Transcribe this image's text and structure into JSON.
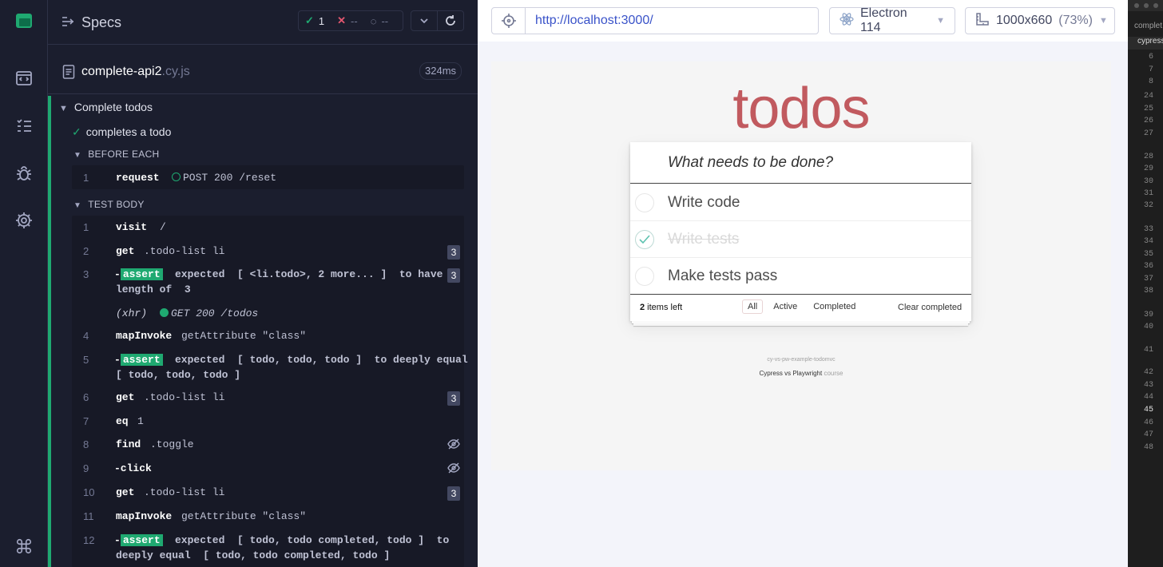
{
  "reporter": {
    "header": {
      "title": "Specs"
    },
    "stats": {
      "passed": "1",
      "failed": "--",
      "pending": "--"
    },
    "spec": {
      "name": "complete-api2",
      "ext": ".cy.js",
      "duration": "324ms"
    },
    "suite": {
      "title": "Complete todos"
    },
    "test": {
      "title": "completes a todo"
    },
    "before_each": {
      "label": "BEFORE EACH",
      "commands": [
        {
          "num": "1",
          "name": "request",
          "msg": "POST 200 /reset"
        }
      ]
    },
    "test_body": {
      "label": "TEST BODY",
      "commands": [
        {
          "num": "1",
          "name": "visit",
          "msg": "/"
        },
        {
          "num": "2",
          "name": "get",
          "msg": ".todo-list li",
          "count": "3"
        },
        {
          "num": "3",
          "name": "-assert",
          "badge": "assert",
          "line1": "expected  [ <li.todo>, 2 more... ]  to have a",
          "line2": "length of  3",
          "count": "3"
        },
        {
          "num": "",
          "name": "(xhr)",
          "msg": "GET 200 /todos"
        },
        {
          "num": "4",
          "name": "mapInvoke",
          "msg": "getAttribute \"class\""
        },
        {
          "num": "5",
          "name": "-assert",
          "badge": "assert",
          "line1": "expected  [ todo, todo, todo ]  to deeply equal",
          "line2": "[ todo, todo, todo ]"
        },
        {
          "num": "6",
          "name": "get",
          "msg": ".todo-list li",
          "count": "3"
        },
        {
          "num": "7",
          "name": "eq",
          "msg": "1"
        },
        {
          "num": "8",
          "name": "find",
          "msg": ".toggle"
        },
        {
          "num": "9",
          "name": "-click",
          "msg": ""
        },
        {
          "num": "10",
          "name": "get",
          "msg": ".todo-list li",
          "count": "3"
        },
        {
          "num": "11",
          "name": "mapInvoke",
          "msg": "getAttribute \"class\""
        },
        {
          "num": "12",
          "name": "-assert",
          "badge": "assert",
          "line1": "expected  [ todo, todo completed, todo ]  to",
          "line2": "deeply equal  [ todo, todo completed, todo ]"
        }
      ]
    }
  },
  "aut": {
    "url": "http://localhost:3000/",
    "browser": "Electron 114",
    "viewport": "1000x660",
    "zoom": "(73%)",
    "app": {
      "title": "todos",
      "placeholder": "What needs to be done?",
      "items": [
        {
          "label": "Write code",
          "completed": false
        },
        {
          "label": "Write tests",
          "completed": true
        },
        {
          "label": "Make tests pass",
          "completed": false
        }
      ],
      "footer": {
        "count": "2",
        "count_suffix": " items left",
        "filters": [
          "All",
          "Active",
          "Completed"
        ],
        "clear": "Clear completed"
      },
      "info_line1": "cy-vs-pw-example-todomvc",
      "info_line2_a": "Cypress vs Playwright",
      "info_line2_b": " course"
    }
  },
  "editor": {
    "tab1": "complet",
    "tab2": "cypress",
    "line_numbers": [
      "6",
      "7",
      "8",
      "24",
      "25",
      "26",
      "27",
      "28",
      "29",
      "30",
      "31",
      "32",
      "33",
      "34",
      "35",
      "36",
      "37",
      "38",
      "39",
      "40",
      "41",
      "42",
      "43",
      "44",
      "45",
      "46",
      "47",
      "48"
    ],
    "current_line": "45"
  },
  "colors": {
    "pass": "#1fa971",
    "fail": "#e45770",
    "todos_red": "#b83f45",
    "url_blue": "#3a53c9"
  }
}
